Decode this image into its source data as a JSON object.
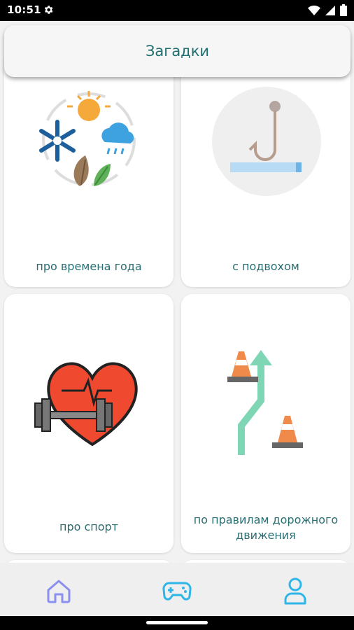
{
  "status_bar": {
    "time": "10:51",
    "icons": [
      "gear-icon",
      "wifi-icon",
      "signal-icon",
      "battery-icon"
    ]
  },
  "app_bar": {
    "title": "Загадки"
  },
  "categories": [
    {
      "label": "про времена года",
      "icon": "seasons-icon"
    },
    {
      "label": "с подвохом",
      "icon": "fishing-hook-icon"
    },
    {
      "label": "про спорт",
      "icon": "heart-dumbbell-icon"
    },
    {
      "label": "по правилам дорожного движения",
      "icon": "traffic-cones-road-icon"
    }
  ],
  "bottom_nav": {
    "items": [
      {
        "icon": "home-icon",
        "active": false
      },
      {
        "icon": "gamepad-icon",
        "active": true
      },
      {
        "icon": "profile-icon",
        "active": false
      }
    ],
    "accent_color": "#2fb6e8",
    "inactive_color": "#8a8ff0"
  },
  "colors": {
    "title_text": "#1f6f6f",
    "card_label": "#2a6e72",
    "background": "#f2f2f2"
  }
}
